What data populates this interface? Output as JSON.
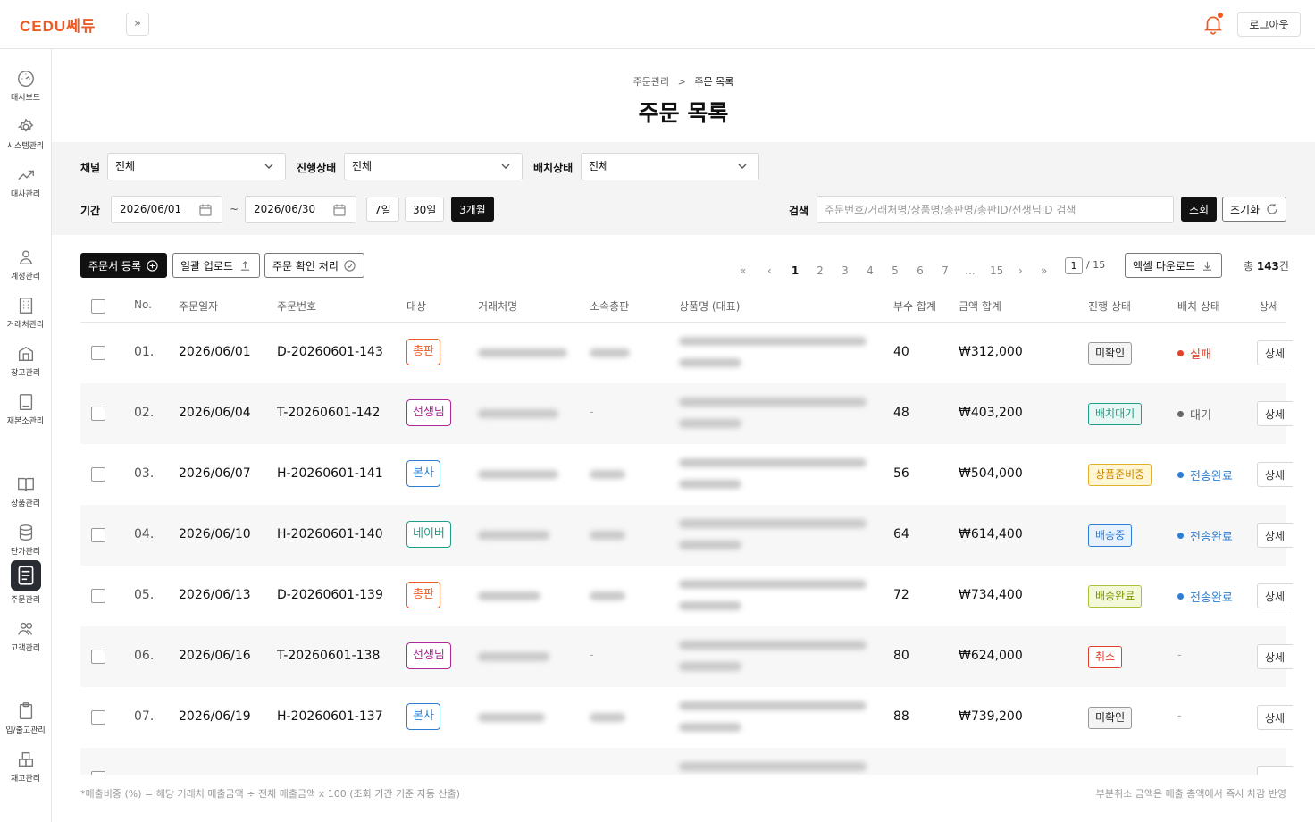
{
  "header": {
    "logo": "CEDU쎄듀",
    "expand_icon": "»",
    "logout": "로그아웃"
  },
  "sidebar": [
    {
      "label": "대시보드",
      "icon": "gauge-icon"
    },
    {
      "label": "시스템관리",
      "icon": "gear-icon"
    },
    {
      "label": "대사관리",
      "icon": "trend-icon"
    },
    {
      "label": "계정관리",
      "icon": "user-icon"
    },
    {
      "label": "거래처관리",
      "icon": "building-icon"
    },
    {
      "label": "창고관리",
      "icon": "warehouse-icon"
    },
    {
      "label": "재본소관리",
      "icon": "book-icon"
    },
    {
      "label": "상품관리",
      "icon": "open-book-icon"
    },
    {
      "label": "단가관리",
      "icon": "database-icon"
    },
    {
      "label": "주문관리",
      "icon": "order-icon",
      "active": true
    },
    {
      "label": "고객관리",
      "icon": "users-icon"
    },
    {
      "label": "입/출고관리",
      "icon": "clipboard-icon"
    },
    {
      "label": "재고관리",
      "icon": "boxes-icon"
    }
  ],
  "breadcrumb": {
    "parent": "주문관리",
    "sep": ">",
    "current": "주문 목록"
  },
  "title": "주문 목록",
  "filters": {
    "channel_label": "채널",
    "channel_value": "전체",
    "progress_label": "진행상태",
    "progress_value": "전체",
    "batch_label": "배치상태",
    "batch_value": "전체",
    "period_label": "기간",
    "date_from": "2026/06/01",
    "tilde": "~",
    "date_to": "2026/06/30",
    "presets": [
      "7일",
      "30일",
      "3개월"
    ],
    "preset_selected": "3개월",
    "search_label": "검색",
    "search_placeholder": "주문번호/거래처명/상품명/총판명/총판ID/선생님ID 검색",
    "search_button": "조회",
    "reset_button": "초기화"
  },
  "toolbar": {
    "register": "주문서 등록",
    "upload": "일괄 업로드",
    "confirm": "주문 확인 처리",
    "excel": "엑셀 다운로드"
  },
  "pagination": {
    "pages": [
      "1",
      "2",
      "3",
      "4",
      "5",
      "6",
      "7",
      "...",
      "15"
    ],
    "current": "1",
    "total_pages": "/ 15"
  },
  "total": {
    "prefix": "총 ",
    "count": "143",
    "suffix": "건"
  },
  "table": {
    "headers": [
      "No.",
      "주문일자",
      "주문번호",
      "대상",
      "거래처명",
      "소속총판",
      "상품명 (대표)",
      "부수 합계",
      "금액 합계",
      "진행 상태",
      "배치 상태",
      "상세"
    ],
    "rows": [
      {
        "no": "01.",
        "date": "2026/06/01",
        "order": "D-20260601-143",
        "target": "총판",
        "qty": "40",
        "amount": "₩312,000",
        "status": "미확인",
        "batch": "실패",
        "detail": "상세"
      },
      {
        "no": "02.",
        "date": "2026/06/04",
        "order": "T-20260601-142",
        "target": "선생님",
        "qty": "48",
        "amount": "₩403,200",
        "status": "배치대기",
        "batch": "대기",
        "detail": "상세"
      },
      {
        "no": "03.",
        "date": "2026/06/07",
        "order": "H-20260601-141",
        "target": "본사",
        "qty": "56",
        "amount": "₩504,000",
        "status": "상품준비중",
        "batch": "전송완료",
        "detail": "상세"
      },
      {
        "no": "04.",
        "date": "2026/06/10",
        "order": "H-20260601-140",
        "target": "네이버",
        "qty": "64",
        "amount": "₩614,400",
        "status": "배송중",
        "batch": "전송완료",
        "detail": "상세"
      },
      {
        "no": "05.",
        "date": "2026/06/13",
        "order": "D-20260601-139",
        "target": "총판",
        "qty": "72",
        "amount": "₩734,400",
        "status": "배송완료",
        "batch": "전송완료",
        "detail": "상세"
      },
      {
        "no": "06.",
        "date": "2026/06/16",
        "order": "T-20260601-138",
        "target": "선생님",
        "qty": "80",
        "amount": "₩624,000",
        "status": "취소",
        "batch": "-",
        "detail": "상세"
      },
      {
        "no": "07.",
        "date": "2026/06/19",
        "order": "H-20260601-137",
        "target": "본사",
        "qty": "88",
        "amount": "₩739,200",
        "status": "미확인",
        "batch": "-",
        "detail": "상세"
      }
    ]
  },
  "footer": {
    "left": "*매출비중 (%) = 해당 거래처 매출금액 ÷ 전체 매출금액 x 100 (조회 기간 기준 자동 산출)",
    "right": "부분취소 금액은 매출 총액에서 즉시 차감 반영"
  },
  "colors": {
    "brand": "#ec5b25",
    "dark": "#111111"
  }
}
